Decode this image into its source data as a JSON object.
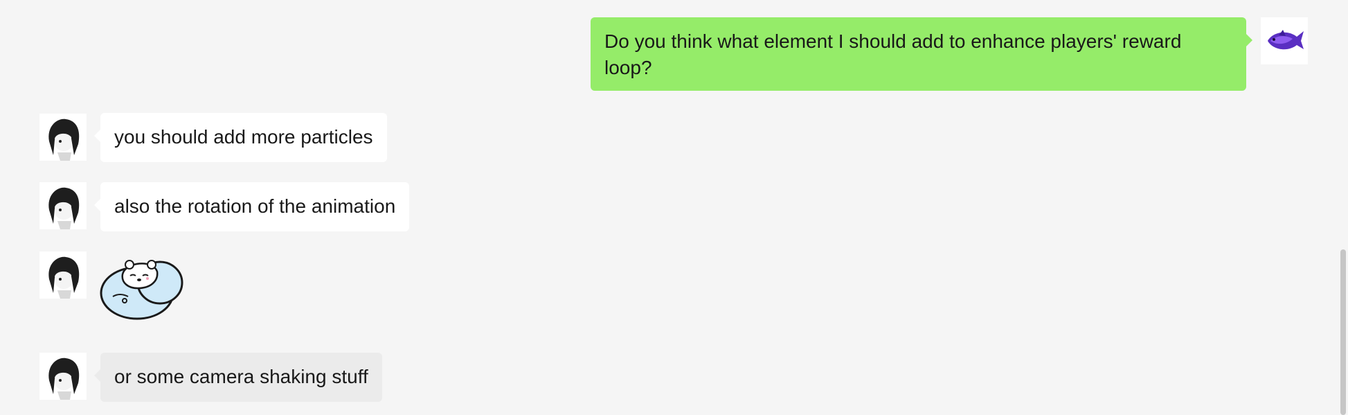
{
  "chat": {
    "messages": [
      {
        "sender": "me",
        "text": "Do you think what element I should add to enhance players' reward loop?"
      },
      {
        "sender": "other",
        "text": "you should add more particles"
      },
      {
        "sender": "other",
        "text": "also the rotation of the animation"
      },
      {
        "sender": "other",
        "type": "sticker",
        "sticker": "sleeping-hamster-sticker"
      },
      {
        "sender": "other",
        "text": "or some camera shaking stuff"
      }
    ]
  },
  "colors": {
    "background": "#f5f5f5",
    "outgoing_bubble": "#95ec69",
    "incoming_bubble": "#ffffff",
    "incoming_bubble_hover": "#ebebeb",
    "text": "#191919"
  },
  "icons": {
    "my_avatar": "purple-fish-avatar",
    "contact_avatar": "anime-girl-avatar"
  }
}
